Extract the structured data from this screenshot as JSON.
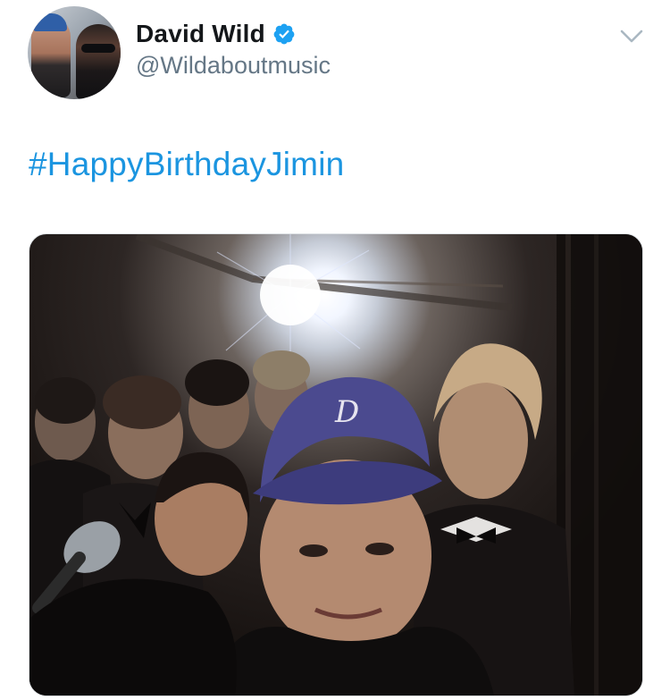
{
  "tweet": {
    "author": {
      "display_name": "David Wild",
      "handle": "@Wildaboutmusic",
      "verified": true,
      "verified_icon": "verified-badge-icon"
    },
    "menu_icon": "chevron-down-icon",
    "text": "#HappyBirthdayJimin",
    "media": {
      "type": "photo"
    }
  },
  "colors": {
    "hashtag": "#1b95e0",
    "name": "#14171a",
    "handle": "#657786",
    "verified": "#1da1f2"
  }
}
